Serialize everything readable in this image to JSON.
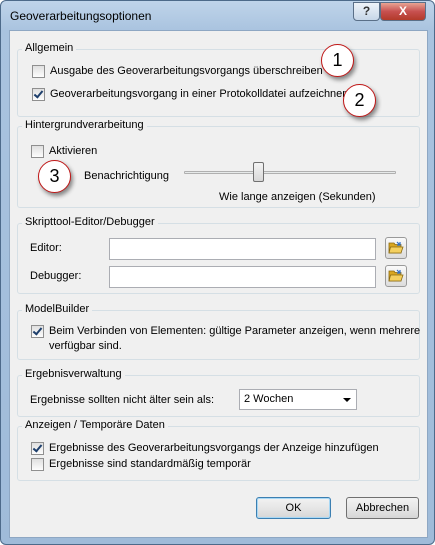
{
  "window": {
    "title": "Geoverarbeitungsoptionen",
    "help_label": "?",
    "close_label": "X"
  },
  "general": {
    "legend": "Allgemein",
    "overwrite": {
      "label": "Ausgabe des Geoverarbeitungsvorgangs überschreiben",
      "checked": false
    },
    "log": {
      "label": "Geoverarbeitungsvorgang in einer Protokolldatei aufzeichnen",
      "checked": true
    }
  },
  "background": {
    "legend": "Hintergrundverarbeitung",
    "enable": {
      "label": "Aktivieren",
      "checked": false
    },
    "notification_label": "Benachrichtigung",
    "slider_caption": "Wie lange anzeigen (Sekunden)",
    "slider_value": 0.35
  },
  "script_tool": {
    "legend": "Skripttool-Editor/Debugger",
    "editor_label": "Editor:",
    "editor_value": "",
    "debugger_label": "Debugger:",
    "debugger_value": ""
  },
  "modelbuilder": {
    "legend": "ModelBuilder",
    "valid_params": {
      "label_line1": "Beim Verbinden von Elementen: gültige Parameter anzeigen, wenn mehrere",
      "label_line2": "verfügbar sind.",
      "checked": true
    }
  },
  "results": {
    "legend": "Ergebnisverwaltung",
    "age_label": "Ergebnisse sollten nicht älter sein als:",
    "age_value": "2 Wochen"
  },
  "display": {
    "legend": "Anzeigen / Temporäre Daten",
    "add_to_display": {
      "label": "Ergebnisse des Geoverarbeitungsvorgangs der Anzeige hinzufügen",
      "checked": true
    },
    "temporary": {
      "label": "Ergebnisse sind standardmäßig temporär",
      "checked": false
    }
  },
  "buttons": {
    "ok": "OK",
    "cancel": "Abbrechen"
  },
  "callouts": [
    "1",
    "2",
    "3"
  ],
  "icons": {
    "folder": "folder-open-icon"
  }
}
